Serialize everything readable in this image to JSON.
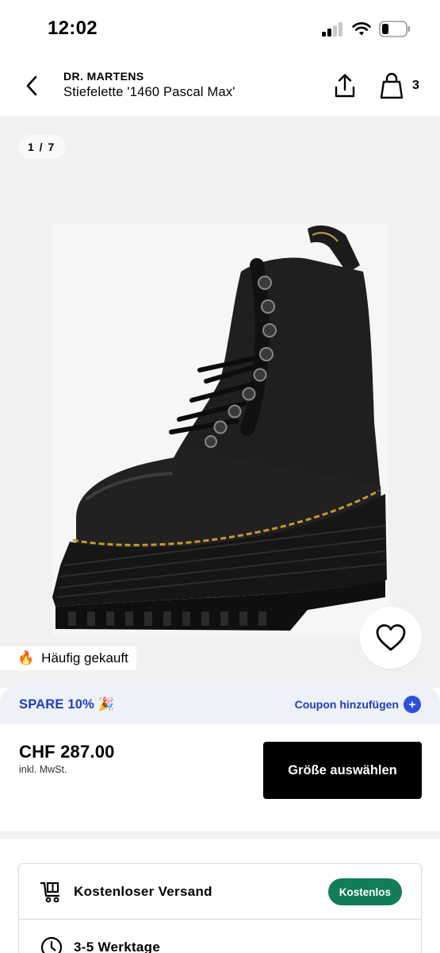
{
  "status_bar": {
    "time": "12:02"
  },
  "header": {
    "brand": "DR. MARTENS",
    "product_name": "Stiefelette '1460 Pascal Max'",
    "bag_count": "3"
  },
  "gallery": {
    "image_counter": "1 / 7",
    "badge_emoji": "🔥",
    "badge_label": "Häufig gekauft"
  },
  "promo": {
    "text": "SPARE 10% 🎉",
    "coupon_label": "Coupon hinzufügen",
    "coupon_plus": "+"
  },
  "price_panel": {
    "price": "CHF 287.00",
    "vat_note": "inkl. MwSt.",
    "size_button": "Größe auswählen"
  },
  "delivery": {
    "shipping_label": "Kostenloser Versand",
    "shipping_badge": "Kostenlos",
    "time_label": "3-5 Werktage"
  },
  "colors": {
    "promo_blue": "#1f3dc4",
    "badge_green": "#117d5a",
    "gallery_bg": "#f1f1f3"
  },
  "icons": [
    "back-icon",
    "share-icon",
    "bag-icon",
    "heart-icon",
    "cart-icon",
    "clock-icon"
  ]
}
